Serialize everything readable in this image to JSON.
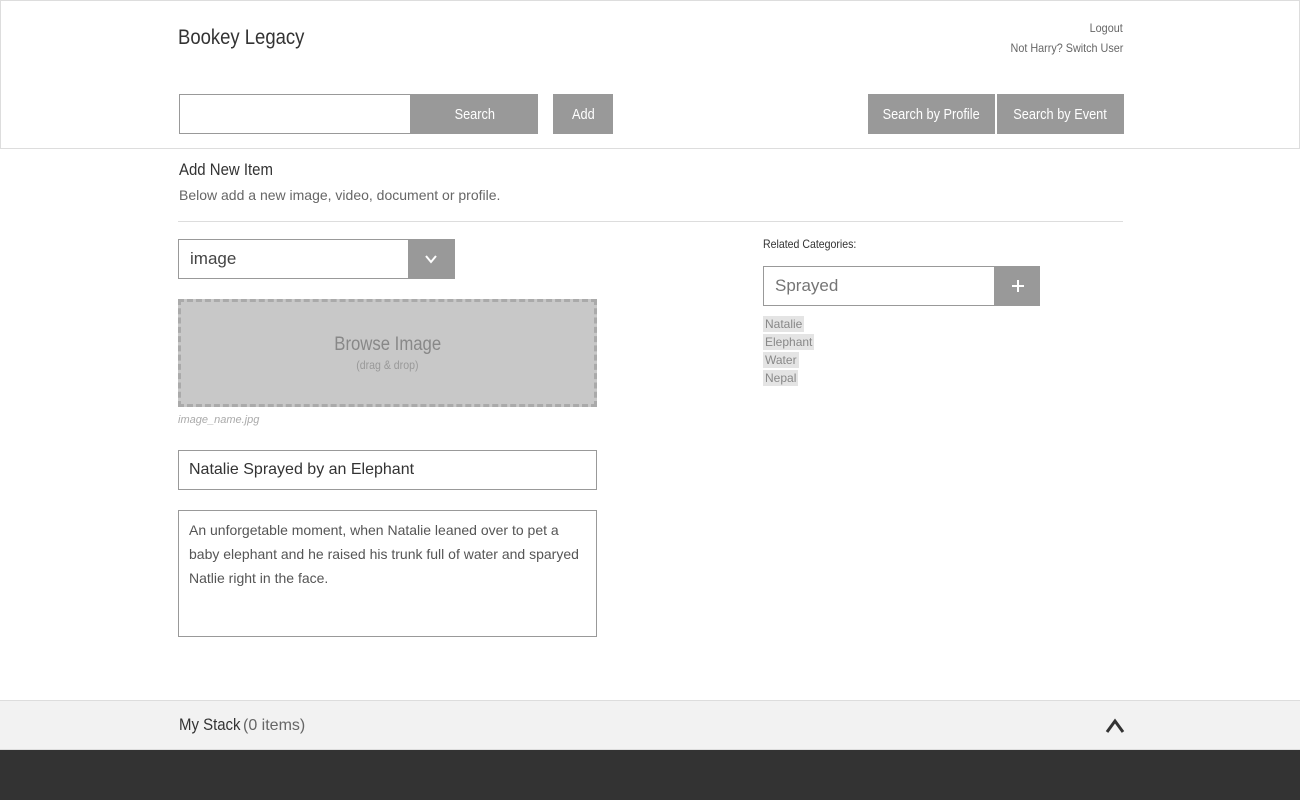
{
  "header": {
    "site_title": "Bookey Legacy",
    "logout_label": "Logout",
    "switch_user_label": "Not Harry? Switch User"
  },
  "toolbar": {
    "search_placeholder": "",
    "search_label": "Search",
    "add_label": "Add",
    "search_by_profile_label": "Search by Profile",
    "search_by_event_label": "Search by Event"
  },
  "main": {
    "title": "Add New Item",
    "subtitle": "Below add a new image, video, document or profile.",
    "type_select": {
      "value": "image",
      "icon": "chevron-down-icon"
    },
    "dropzone": {
      "title": "Browse Image",
      "subtitle": "(drag & drop)"
    },
    "file_name": "image_name.jpg",
    "item_title": "Natalie Sprayed by an Elephant",
    "description": "An unforgetable moment, when Natalie leaned over to pet a baby elephant and he raised his trunk full of water and sparyed Natlie right in the face."
  },
  "categories": {
    "label": "Related Categories:",
    "input_placeholder": "Sprayed",
    "add_icon": "plus-icon",
    "tags": [
      "Natalie",
      "Elephant",
      "Water",
      "Nepal"
    ]
  },
  "stack": {
    "title": "My Stack",
    "count": "(0 items)",
    "toggle_icon": "chevron-up-icon"
  },
  "colors": {
    "button": "#999999",
    "footer": "#333333",
    "stack_bar": "#f2f2f2",
    "border": "#dddddd"
  }
}
